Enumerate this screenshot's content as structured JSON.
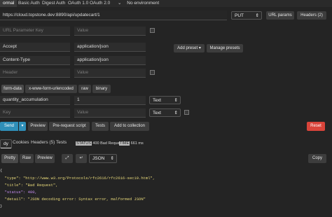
{
  "auth_tabs": [
    "ormal",
    "Basic Auth",
    "Digest Auth",
    "OAuth 1.0",
    "OAuth 2.0"
  ],
  "environment": "No environment",
  "request": {
    "url": "https://cloud.topstone.dev:8890/api/updatecart/1",
    "method": "PUT",
    "url_params_label": "URL params",
    "headers_label": "Headers (2)"
  },
  "url_param_row": {
    "key_placeholder": "URL Parameter Key",
    "value_placeholder": "Value"
  },
  "headers": [
    {
      "key": "Accept",
      "value": "application/json"
    },
    {
      "key": "Content-Type",
      "value": "application/json"
    }
  ],
  "header_placeholder": {
    "key": "Header",
    "value": "Value"
  },
  "preset": {
    "add_label": "Add preset ▾",
    "manage_label": "Manage presets"
  },
  "body_tabs": [
    "form-data",
    "x-www-form-urlencoded",
    "raw",
    "binary"
  ],
  "form_rows": [
    {
      "key": "quantity_accumulation",
      "value": "1",
      "type": "Text"
    }
  ],
  "form_placeholder": {
    "key": "Key",
    "value": "Value",
    "type": "Text"
  },
  "actions": {
    "send": "Send",
    "preview": "Preview",
    "prerequest": "Pre-request script",
    "tests": "Tests",
    "add_collection": "Add to collection",
    "reset": "Reset"
  },
  "response": {
    "tabs": [
      "dy",
      "Cookies",
      "Headers (5)",
      "Tests"
    ],
    "status_label": "STATUS",
    "status_value": "400 Bad Request",
    "time_label": "TIME",
    "time_value": "661 ms",
    "view_tabs": [
      "Pretty",
      "Raw",
      "Preview"
    ],
    "format": "JSON",
    "copy_label": "Copy",
    "body_lines": [
      "{",
      "  \"type\": \"http://www.w3.org/Protocols/rfc2616/rfc2616-sec10.html\",",
      "  \"title\": \"Bad Request\",",
      "  \"status\": 400,",
      "  \"detail\": \"JSON decoding error: Syntax error, malformed JSON\"",
      "}"
    ]
  },
  "colors": {
    "send": "#2f8fb8",
    "reset": "#d9443a",
    "string": "#e8d97a",
    "key": "#8fc0e0",
    "number": "#c58cf0"
  }
}
